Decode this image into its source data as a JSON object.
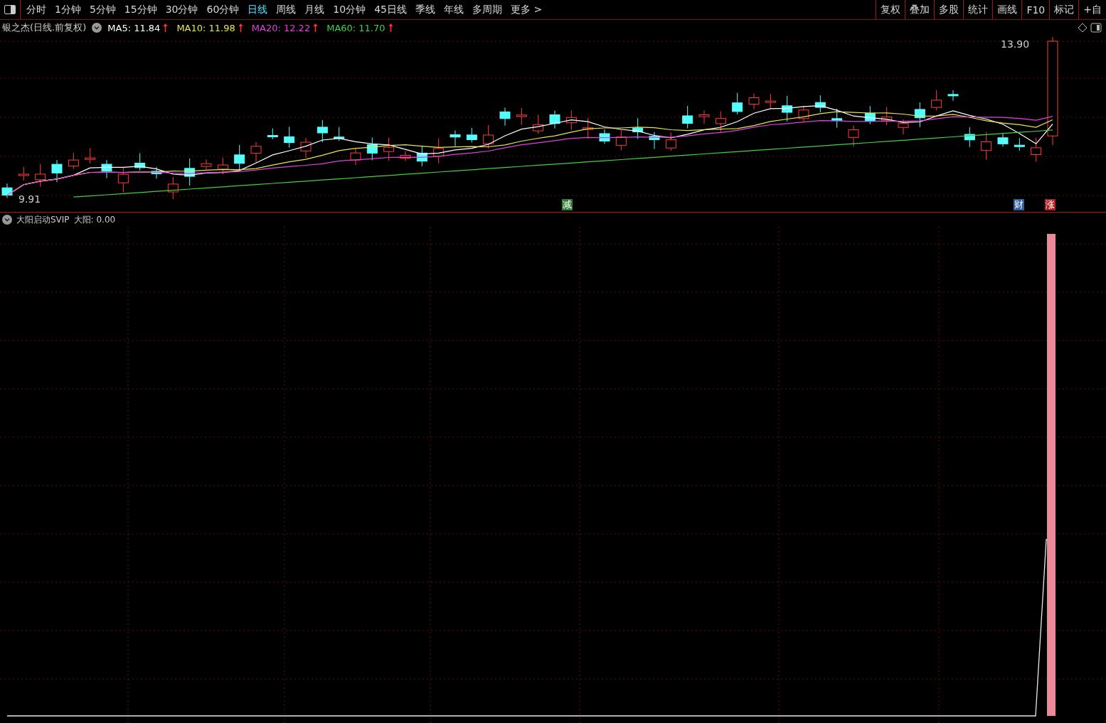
{
  "toolbar": {
    "periods": [
      {
        "label": "分时",
        "selected": false
      },
      {
        "label": "1分钟",
        "selected": false
      },
      {
        "label": "5分钟",
        "selected": false
      },
      {
        "label": "15分钟",
        "selected": false
      },
      {
        "label": "30分钟",
        "selected": false
      },
      {
        "label": "60分钟",
        "selected": false
      },
      {
        "label": "日线",
        "selected": true
      },
      {
        "label": "周线",
        "selected": false
      },
      {
        "label": "月线",
        "selected": false
      },
      {
        "label": "10分钟",
        "selected": false
      },
      {
        "label": "45日线",
        "selected": false
      },
      {
        "label": "季线",
        "selected": false
      },
      {
        "label": "年线",
        "selected": false
      },
      {
        "label": "多周期",
        "selected": false
      }
    ],
    "more": "更多 >",
    "actions": [
      "复权",
      "叠加",
      "多股",
      "统计",
      "画线",
      "F10",
      "标记",
      "+自"
    ]
  },
  "price_chart": {
    "title": "银之杰(日线.前复权)",
    "averages": [
      {
        "label": "MA5: 11.84",
        "color": "#ffffff"
      },
      {
        "label": "MA10: 11.98",
        "color": "#e6e64c"
      },
      {
        "label": "MA20: 12.22",
        "color": "#e040e0"
      },
      {
        "label": "MA60: 11.70",
        "color": "#40d040"
      }
    ],
    "high_label": "13.90",
    "low_label": "9.91",
    "markers": [
      {
        "text": "减",
        "color": "#2e7d32"
      },
      {
        "text": "财",
        "color": "#2f5f9e"
      },
      {
        "text": "涨",
        "color": "#b02020"
      }
    ]
  },
  "indicator": {
    "title": "大阳启动SVIP",
    "reading": "大阳: 0.00"
  }
}
